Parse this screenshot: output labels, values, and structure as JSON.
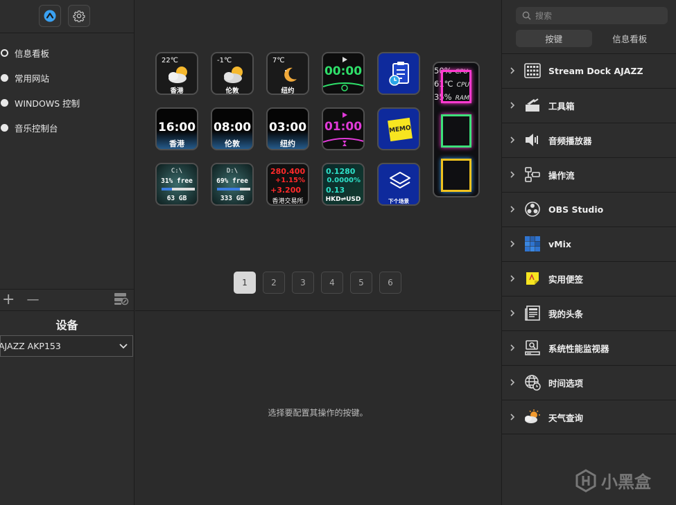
{
  "profiles": [
    {
      "label": "信息看板",
      "selected": true
    },
    {
      "label": "常用网站",
      "selected": false
    },
    {
      "label": "WINDOWS 控制",
      "selected": false
    },
    {
      "label": "音乐控制台",
      "selected": false
    }
  ],
  "toolbar": {
    "add": "+",
    "remove": "—"
  },
  "device": {
    "title": "设备",
    "selected": "AJAZZ AKP153"
  },
  "keys": {
    "w1": {
      "temp": "22℃",
      "city": "香港"
    },
    "w2": {
      "temp": "-1℃",
      "city": "伦敦"
    },
    "w3": {
      "temp": "7℃",
      "city": "纽约"
    },
    "timer1": "00:00",
    "c1": {
      "time": "16:00",
      "city": "香港"
    },
    "c2": {
      "time": "08:00",
      "city": "伦敦"
    },
    "c3": {
      "time": "03:00",
      "city": "纽约"
    },
    "timer2": "01:00",
    "memo": "MEMO",
    "d1": {
      "drive": "C:\\",
      "free": "31% free",
      "size": "63 GB"
    },
    "d2": {
      "drive": "D:\\",
      "free": "69% free",
      "size": "333 GB"
    },
    "stock": {
      "price": "280.400",
      "pct": "+1.15%",
      "chg": "+3.200",
      "name": "香港交易所"
    },
    "fx": {
      "rate": "0.1280",
      "pct": "0.0000%",
      "chg": "0.13",
      "pair": "HKD⇌USD"
    },
    "next": "下个场景",
    "cpu1": {
      "value": "50%",
      "label": "CPU"
    },
    "cpu2": {
      "value": "61℃",
      "label": "CPU"
    },
    "ram": {
      "value": "35%",
      "label": "RAM"
    }
  },
  "pages": [
    "1",
    "2",
    "3",
    "4",
    "5",
    "6"
  ],
  "center_hint": "选择要配置其操作的按键。",
  "right": {
    "search_placeholder": "搜索",
    "tabs": [
      "按键",
      "信息看板"
    ],
    "categories": [
      {
        "label": "Stream Dock AJAZZ",
        "icon": "keypad-icon"
      },
      {
        "label": "工具箱",
        "icon": "toolbox-icon"
      },
      {
        "label": "音频播放器",
        "icon": "speaker-icon"
      },
      {
        "label": "操作流",
        "icon": "workflow-icon"
      },
      {
        "label": "OBS Studio",
        "icon": "obs-icon"
      },
      {
        "label": "vMix",
        "icon": "vmix-icon"
      },
      {
        "label": "实用便签",
        "icon": "sticky-note-icon"
      },
      {
        "label": "我的头条",
        "icon": "newspaper-icon"
      },
      {
        "label": "系统性能监视器",
        "icon": "monitor-icon"
      },
      {
        "label": "时间选项",
        "icon": "globe-clock-icon"
      },
      {
        "label": "天气查询",
        "icon": "weather-icon"
      }
    ]
  },
  "watermark": "小黑盒"
}
